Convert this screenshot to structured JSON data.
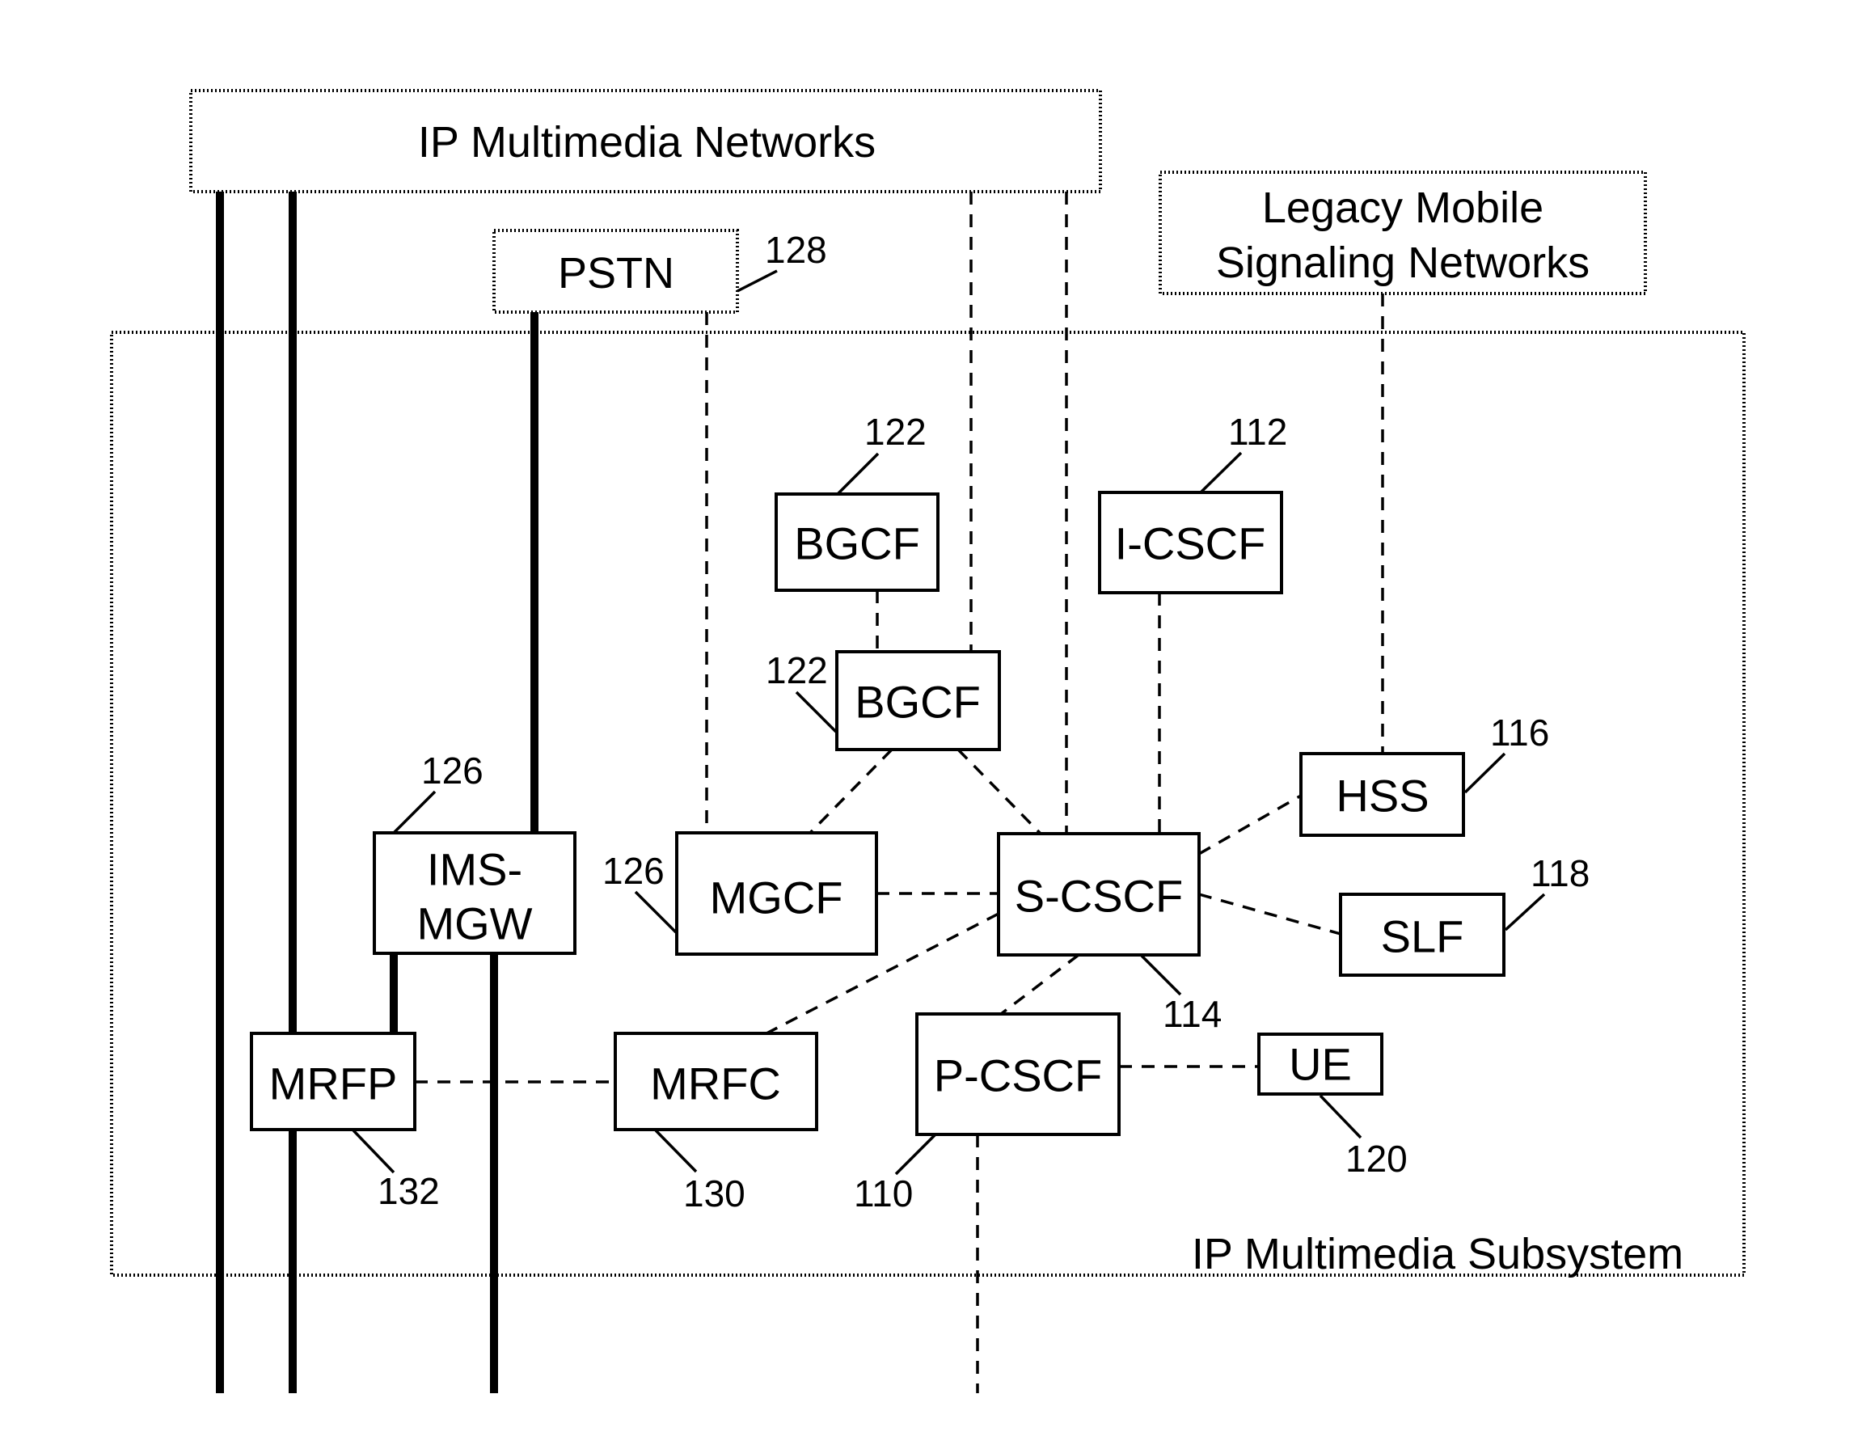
{
  "figure": {
    "regions": {
      "ip_multimedia_networks": "IP Multimedia Networks",
      "legacy_mobile_signaling_networks": [
        "Legacy Mobile",
        "Signaling Networks"
      ],
      "pstn": "PSTN",
      "ip_multimedia_subsystem": "IP Multimedia Subsystem"
    },
    "nodes": {
      "bgcf_top": "BGCF",
      "bgcf": "BGCF",
      "i_cscf": "I-CSCF",
      "ims_mgw": [
        "IMS-",
        "MGW"
      ],
      "mgcf": "MGCF",
      "s_cscf": "S-CSCF",
      "hss": "HSS",
      "slf": "SLF",
      "mrfp": "MRFP",
      "mrfc": "MRFC",
      "p_cscf": "P-CSCF",
      "ue": "UE"
    },
    "reference_numerals": {
      "pstn": "128",
      "bgcf_top": "122",
      "bgcf": "122",
      "i_cscf": "112",
      "ims_mgw": "126",
      "mgcf": "126",
      "hss": "116",
      "slf": "118",
      "s_cscf": "114",
      "ue": "120",
      "mrfp": "132",
      "mrfc": "130",
      "p_cscf": "110"
    },
    "connections": [
      {
        "from": "IP Multimedia Networks",
        "to": "MRFP / bottom",
        "style": "bearer"
      },
      {
        "from": "IP Multimedia Networks",
        "to": "MRFP / bottom",
        "style": "bearer"
      },
      {
        "from": "PSTN",
        "to": "IMS-MGW",
        "style": "bearer"
      },
      {
        "from": "IMS-MGW",
        "to": "MRFP",
        "style": "bearer"
      },
      {
        "from": "IMS-MGW",
        "to": "bottom",
        "style": "bearer"
      },
      {
        "from": "PSTN",
        "to": "MGCF",
        "style": "signaling"
      },
      {
        "from": "IP Multimedia Networks",
        "to": "BGCF",
        "style": "signaling"
      },
      {
        "from": "IP Multimedia Networks",
        "to": "S-CSCF",
        "style": "signaling"
      },
      {
        "from": "Legacy Mobile Signaling Networks",
        "to": "HSS",
        "style": "signaling"
      },
      {
        "from": "BGCF",
        "to": "BGCF",
        "style": "signaling"
      },
      {
        "from": "BGCF",
        "to": "MGCF",
        "style": "signaling"
      },
      {
        "from": "BGCF",
        "to": "S-CSCF",
        "style": "signaling"
      },
      {
        "from": "I-CSCF",
        "to": "S-CSCF",
        "style": "signaling"
      },
      {
        "from": "MGCF",
        "to": "S-CSCF",
        "style": "signaling"
      },
      {
        "from": "S-CSCF",
        "to": "HSS",
        "style": "signaling"
      },
      {
        "from": "S-CSCF",
        "to": "SLF",
        "style": "signaling"
      },
      {
        "from": "S-CSCF",
        "to": "MRFC",
        "style": "signaling"
      },
      {
        "from": "S-CSCF",
        "to": "P-CSCF",
        "style": "signaling"
      },
      {
        "from": "MRFP",
        "to": "MRFC",
        "style": "signaling"
      },
      {
        "from": "P-CSCF",
        "to": "UE",
        "style": "signaling"
      },
      {
        "from": "P-CSCF",
        "to": "bottom",
        "style": "signaling"
      }
    ]
  }
}
